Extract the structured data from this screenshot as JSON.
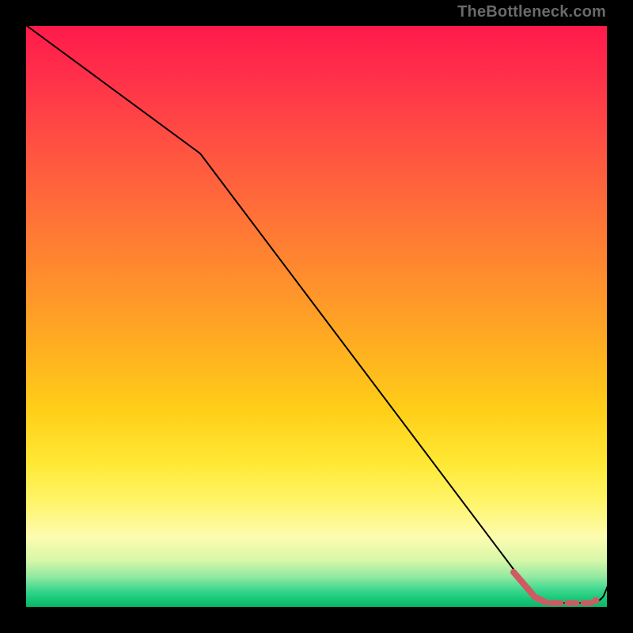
{
  "watermark": "TheBottleneck.com",
  "colors": {
    "accent_dash": "#cf5a63",
    "curve": "#000000",
    "frame": "#000000"
  },
  "chart_data": {
    "type": "line",
    "title": "",
    "xlabel": "",
    "ylabel": "",
    "xlim": [
      0,
      100
    ],
    "ylim": [
      0,
      100
    ],
    "grid": false,
    "legend": null,
    "series": [
      {
        "name": "curve",
        "style": "solid",
        "x": [
          0,
          30,
          85,
          88,
          90,
          92,
          94,
          96,
          98,
          100
        ],
        "values": [
          100,
          78,
          5,
          1,
          0,
          0,
          0,
          0,
          0,
          5
        ]
      },
      {
        "name": "marker-dash",
        "style": "dashed",
        "color": "#cf5a63",
        "x": [
          84,
          86,
          88,
          90,
          92,
          94,
          96
        ],
        "values": [
          6,
          3,
          1,
          0.5,
          0.5,
          0.5,
          0.5
        ]
      }
    ],
    "annotations": [
      {
        "type": "point",
        "name": "marker-dot",
        "x": 96,
        "y": 0.5,
        "color": "#cf5a63"
      }
    ]
  }
}
